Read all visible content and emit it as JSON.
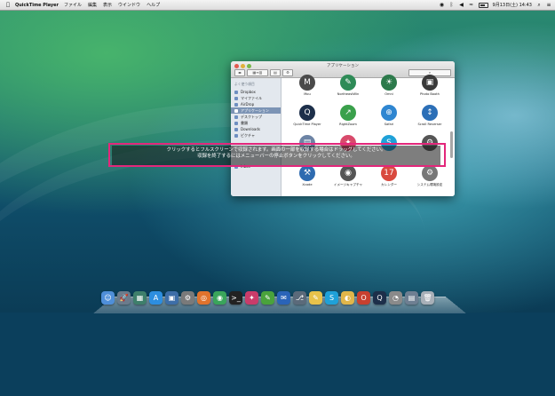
{
  "menubar": {
    "app": "QuickTime Player",
    "items": [
      "ファイル",
      "編集",
      "表示",
      "ウインドウ",
      "ヘルプ"
    ],
    "clock": "9月13日(土) 14:43",
    "icons": [
      "apple-logo",
      "camera-icon",
      "bluetooth-icon",
      "volume-icon",
      "wifi-icon",
      "battery-icon",
      "search-icon",
      "list-icon"
    ]
  },
  "finder": {
    "title": "アプリケーション",
    "sidebar": {
      "section": "よく使う項目",
      "items": [
        "Dropbox",
        "マイファイル",
        "AirDrop",
        "アプリケーション",
        "デスクトップ",
        "書類",
        "Downloads",
        "ピクチャ",
        "inbox"
      ],
      "selected": "アプリケーション"
    },
    "apps": [
      {
        "label": "Mou",
        "color": "#4a4a4a",
        "glyph": "M"
      },
      {
        "label": "NortheastWin",
        "color": "#2e8b57",
        "glyph": "✎"
      },
      {
        "label": "Omni",
        "color": "#2c7a4b",
        "glyph": "☀"
      },
      {
        "label": "Photo Booth",
        "color": "#3a3a3a",
        "glyph": "▣"
      },
      {
        "label": "QuickTime Player",
        "color": "#1d2f4a",
        "glyph": "Q"
      },
      {
        "label": "RightZoom",
        "color": "#3aa04b",
        "glyph": "↗"
      },
      {
        "label": "Safari",
        "color": "#2f86d1",
        "glyph": "⊕"
      },
      {
        "label": "Scroll Reverser",
        "color": "#2c6fb7",
        "glyph": "↕"
      },
      {
        "label": "",
        "color": "#6d84a5",
        "glyph": "▤"
      },
      {
        "label": "",
        "color": "#d84a6b",
        "glyph": "✦"
      },
      {
        "label": "",
        "color": "#1fa1d8",
        "glyph": "S"
      },
      {
        "label": "",
        "color": "#555555",
        "glyph": "⚙"
      },
      {
        "label": "Xcode",
        "color": "#2e6bb0",
        "glyph": "⚒"
      },
      {
        "label": "イメージキャプチャ",
        "color": "#555555",
        "glyph": "◉"
      },
      {
        "label": "カレンダー",
        "color": "#d94a3f",
        "glyph": "17"
      },
      {
        "label": "システム環境設定",
        "color": "#777777",
        "glyph": "⚙"
      }
    ]
  },
  "caption": {
    "line1": "クリックするとフルスクリーンで収録されます。画面の一部を収録する場合はドラッグしてください。",
    "line2": "収録を終了するにはメニューバーの停止ボタンをクリックしてください。"
  },
  "dock": {
    "icons": [
      {
        "name": "finder",
        "color": "#4f8fd9",
        "glyph": "☺"
      },
      {
        "name": "launchpad",
        "color": "#6b7b8c",
        "glyph": "🚀"
      },
      {
        "name": "mission-control",
        "color": "#3e7f6b",
        "glyph": "▦"
      },
      {
        "name": "app-store",
        "color": "#2d8ee0",
        "glyph": "A"
      },
      {
        "name": "preview",
        "color": "#3d6ea8",
        "glyph": "▣"
      },
      {
        "name": "system-preferences",
        "color": "#7a7a7a",
        "glyph": "⚙"
      },
      {
        "name": "firefox",
        "color": "#e0732d",
        "glyph": "◎"
      },
      {
        "name": "chrome",
        "color": "#3aa55b",
        "glyph": "◉"
      },
      {
        "name": "terminal",
        "color": "#222222",
        "glyph": ">_"
      },
      {
        "name": "scroll",
        "color": "#c93c6a",
        "glyph": "✦"
      },
      {
        "name": "evernote",
        "color": "#4aa33c",
        "glyph": "✎"
      },
      {
        "name": "thunderbird",
        "color": "#2a64b8",
        "glyph": "✉"
      },
      {
        "name": "sourcetree",
        "color": "#5b6a7a",
        "glyph": "⎇"
      },
      {
        "name": "textedit",
        "color": "#e8c24a",
        "glyph": "✎"
      },
      {
        "name": "skype",
        "color": "#1fa1d8",
        "glyph": "S"
      },
      {
        "name": "cyberduck",
        "color": "#e0b64a",
        "glyph": "◐"
      },
      {
        "name": "office",
        "color": "#c8402f",
        "glyph": "O"
      },
      {
        "name": "quicktime",
        "color": "#1d2f4a",
        "glyph": "Q"
      },
      {
        "name": "unknown-app",
        "color": "#8a8a8a",
        "glyph": "◔"
      },
      {
        "name": "document-stack",
        "color": "#6e7f92",
        "glyph": "▤"
      },
      {
        "name": "trash",
        "color": "#a8b0b8",
        "glyph": "🗑"
      }
    ]
  }
}
